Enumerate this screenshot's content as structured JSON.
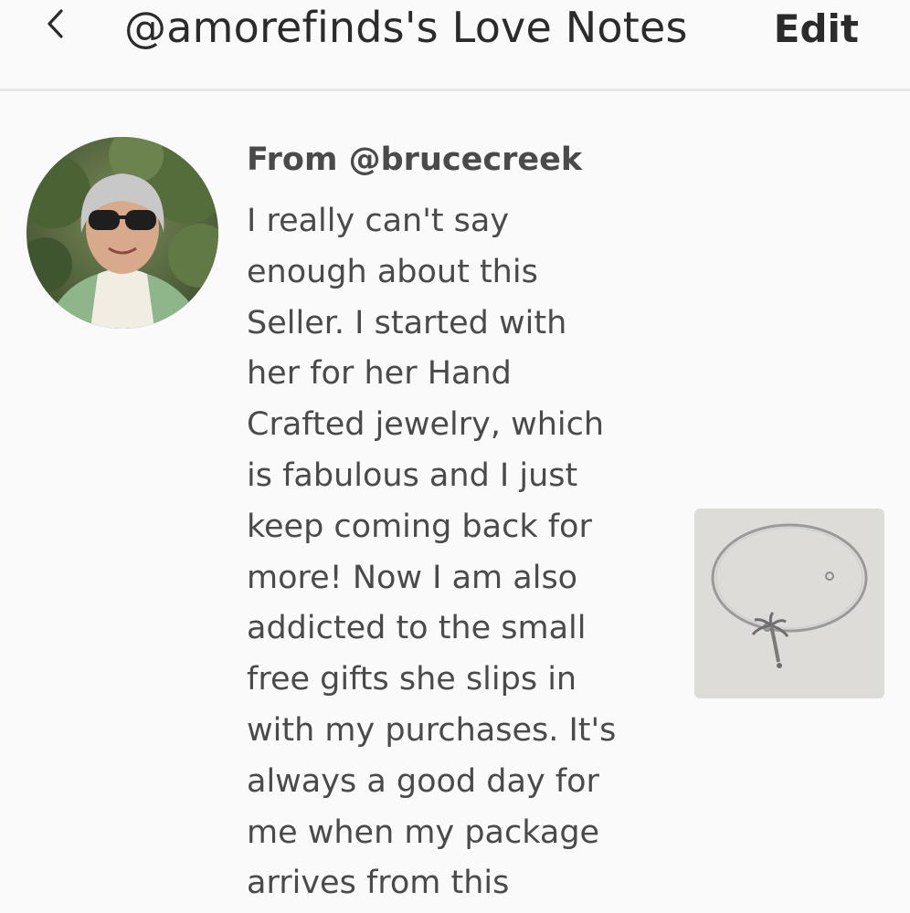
{
  "header": {
    "back_icon": "chevron-left-icon",
    "title": "@amorefinds's Love Notes",
    "edit_label": "Edit"
  },
  "note": {
    "from": "From @brucecreek",
    "message_lines": [
      "I really can't say",
      "enough about this",
      "Seller. I started with",
      "her for her Hand",
      "Crafted jewelry, which",
      "is fabulous and I just",
      "keep coming back for",
      "more! Now I am also",
      "addicted to the small",
      "free gifts she slips in",
      "with my purchases. It's",
      "always a good day for",
      "me when my package",
      "arrives from this"
    ]
  },
  "colors": {
    "background": "#fafafa",
    "divider": "#e6e6e6",
    "text": "#4a4a4a",
    "title_text": "#2b2b2b"
  }
}
